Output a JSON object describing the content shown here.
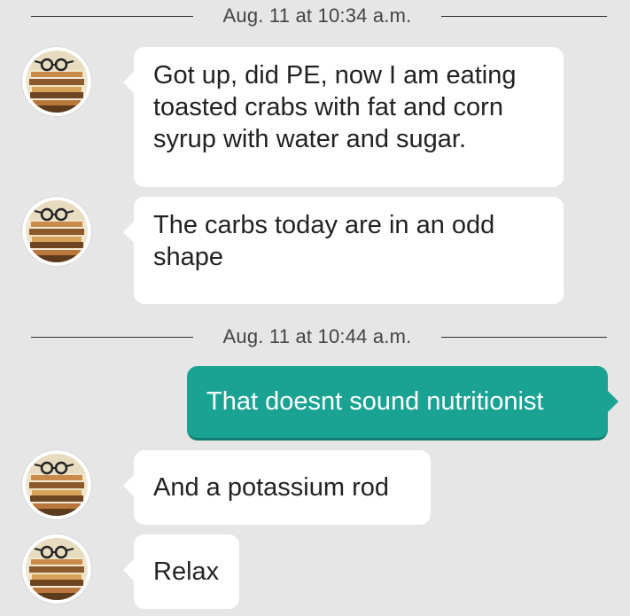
{
  "conversation": {
    "separators": [
      {
        "timestamp": "Aug. 11 at 10:34 a.m."
      },
      {
        "timestamp": "Aug. 11 at 10:44 a.m."
      }
    ],
    "messages": [
      {
        "direction": "incoming",
        "text": "Got up, did PE, now I am eating toasted crabs with fat and corn syrup with water and sugar."
      },
      {
        "direction": "incoming",
        "text": "The carbs today are in an odd shape"
      },
      {
        "direction": "outgoing",
        "text": "That doesnt sound nutritionist"
      },
      {
        "direction": "incoming",
        "text": "And a potassium rod"
      },
      {
        "direction": "incoming",
        "text": "Relax"
      }
    ],
    "avatar_icon": "books-glasses-icon"
  },
  "colors": {
    "background": "#e6e6e6",
    "incoming_bubble": "#ffffff",
    "outgoing_bubble": "#1aa393",
    "outgoing_text": "#ffffff"
  }
}
